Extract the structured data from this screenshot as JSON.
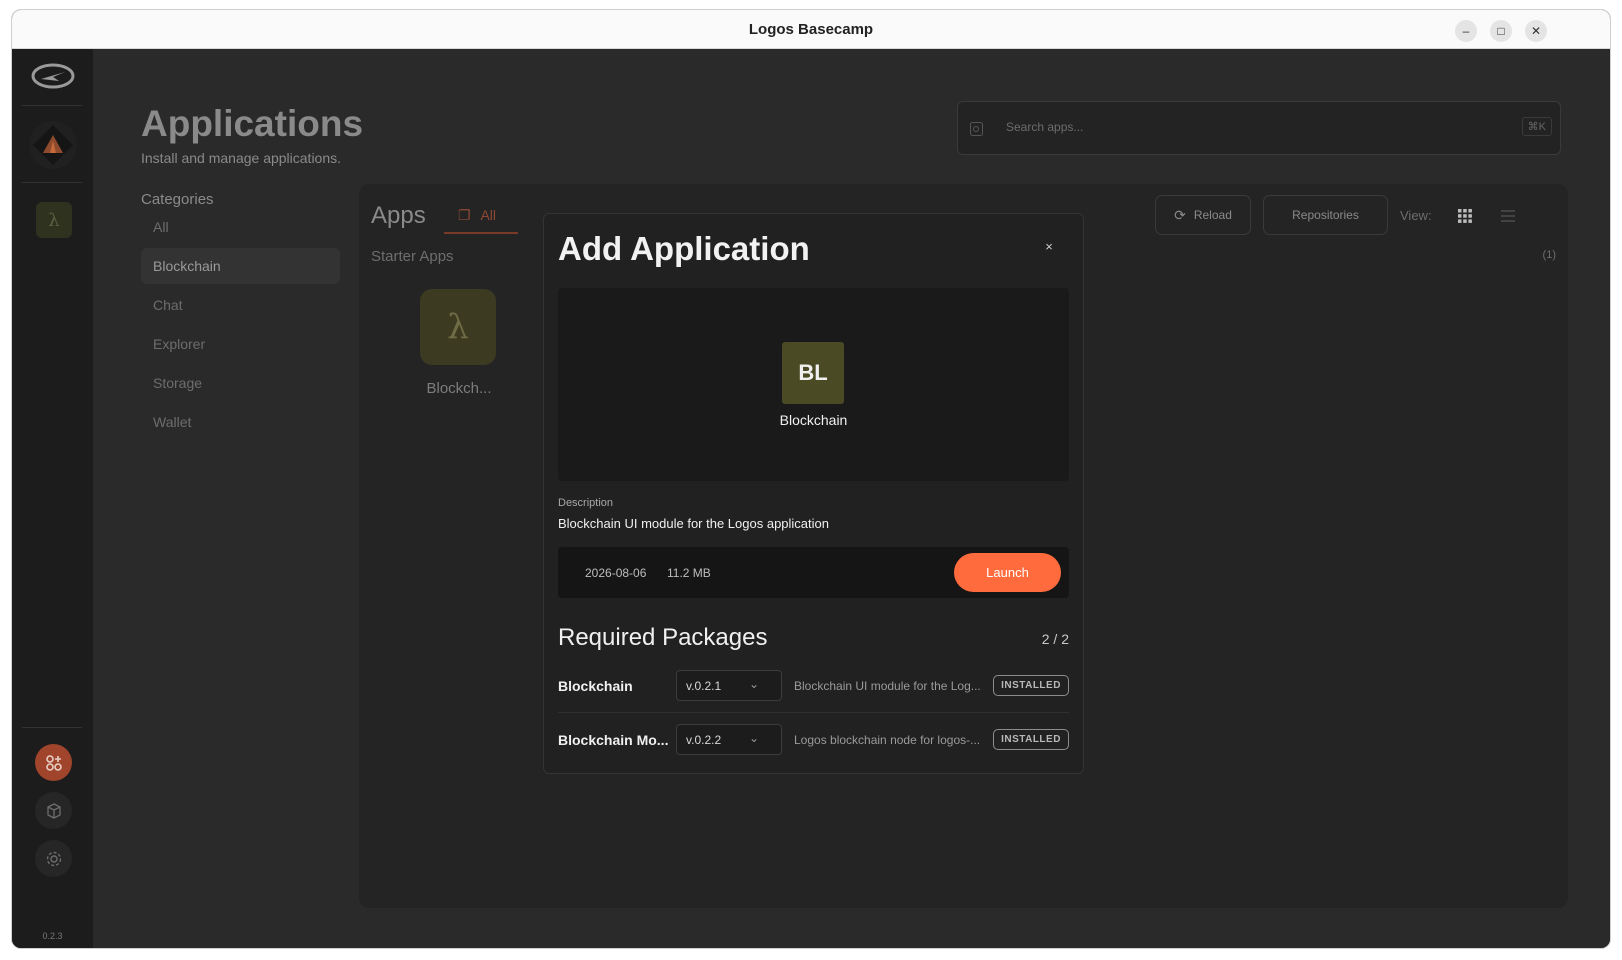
{
  "window": {
    "title": "Logos Basecamp"
  },
  "rail": {
    "version": "0.2.3"
  },
  "page": {
    "title": "Applications",
    "subtitle": "Install and manage applications."
  },
  "search": {
    "placeholder": "Search apps...",
    "shortcut": "⌘K"
  },
  "categories": {
    "title": "Categories",
    "items": [
      "All",
      "Blockchain",
      "Chat",
      "Explorer",
      "Storage",
      "Wallet"
    ],
    "selected": "Blockchain"
  },
  "apps_panel": {
    "title": "Apps",
    "tab_all": "All",
    "section": "Starter Apps",
    "reload_label": "Reload",
    "repositories_label": "Repositories",
    "view_label": "View:",
    "count": "(1)",
    "tile": {
      "glyph": "λ",
      "label": "Blockch..."
    }
  },
  "modal": {
    "title": "Add Application",
    "close": "×",
    "app_initials": "BL",
    "app_name": "Blockchain",
    "description_label": "Description",
    "description": "Blockchain UI module for the Logos application",
    "date": "2026-08-06",
    "size": "11.2 MB",
    "launch_label": "Launch",
    "required_title": "Required Packages",
    "required_count": "2 / 2",
    "packages": [
      {
        "name": "Blockchain",
        "version": "v.0.2.1",
        "desc": "Blockchain UI module for the Log...",
        "status": "INSTALLED"
      },
      {
        "name": "Blockchain Mo...",
        "version": "v.0.2.2",
        "desc": "Logos blockchain node for logos-...",
        "status": "INSTALLED"
      }
    ]
  },
  "colors": {
    "accent": "#ff6b3d",
    "tile_olive": "#4a4a24"
  }
}
